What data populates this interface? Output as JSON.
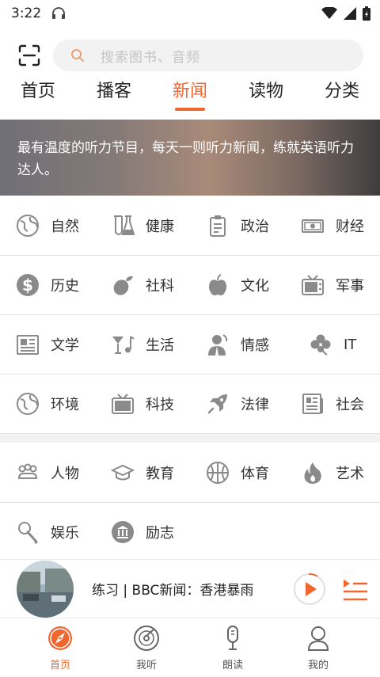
{
  "status": {
    "time": "3:22"
  },
  "search": {
    "placeholder": "搜索图书、音频"
  },
  "tabs": [
    {
      "label": "首页"
    },
    {
      "label": "播客"
    },
    {
      "label": "新闻"
    },
    {
      "label": "读物"
    },
    {
      "label": "分类"
    }
  ],
  "banner": {
    "text": "最有温度的听力节目，每天一则听力新闻，练就英语听力达人。"
  },
  "categories": [
    {
      "label": "自然",
      "icon": "globe-icon"
    },
    {
      "label": "健康",
      "icon": "flask-icon"
    },
    {
      "label": "政治",
      "icon": "clipboard-icon"
    },
    {
      "label": "财经",
      "icon": "money-icon"
    },
    {
      "label": "历史",
      "icon": "dollar-coin-icon"
    },
    {
      "label": "社科",
      "icon": "fruit-icon"
    },
    {
      "label": "文化",
      "icon": "apple-icon"
    },
    {
      "label": "军事",
      "icon": "tv-icon"
    },
    {
      "label": "文学",
      "icon": "newspaper-icon"
    },
    {
      "label": "生活",
      "icon": "cocktail-music-icon"
    },
    {
      "label": "情感",
      "icon": "person-icon"
    },
    {
      "label": "IT",
      "icon": "clover-icon"
    },
    {
      "label": "环境",
      "icon": "globe-icon"
    },
    {
      "label": "科技",
      "icon": "tv-icon"
    },
    {
      "label": "法律",
      "icon": "rocket-icon"
    },
    {
      "label": "社会",
      "icon": "document-icon"
    },
    {
      "label": "人物",
      "icon": "people-icon"
    },
    {
      "label": "教育",
      "icon": "graduation-cap-icon"
    },
    {
      "label": "体育",
      "icon": "basketball-icon"
    },
    {
      "label": "艺术",
      "icon": "flame-icon"
    },
    {
      "label": "娱乐",
      "icon": "microphone-icon"
    },
    {
      "label": "励志",
      "icon": "bank-icon"
    }
  ],
  "player": {
    "title": "练习 | BBC新闻：香港暴雨",
    "progress": 0.08
  },
  "bottom_nav": [
    {
      "label": "首页",
      "icon": "compass-icon"
    },
    {
      "label": "我听",
      "icon": "vinyl-icon"
    },
    {
      "label": "朗读",
      "icon": "microphone-icon"
    },
    {
      "label": "我的",
      "icon": "user-icon"
    }
  ],
  "colors": {
    "accent": "#f0662e",
    "icon_gray": "#8a8a8a"
  }
}
